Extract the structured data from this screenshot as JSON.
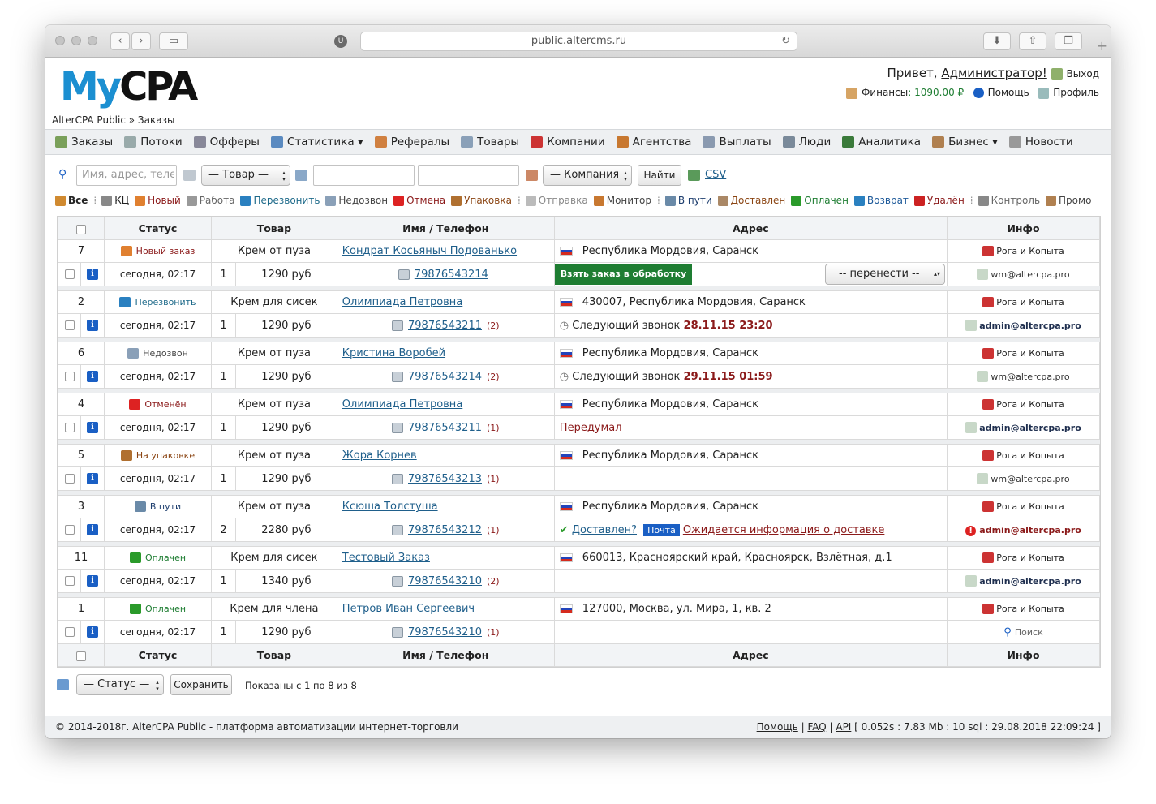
{
  "browser": {
    "url": "public.altercms.ru"
  },
  "header": {
    "logo_my": "My",
    "logo_cpa": "CPA",
    "greeting": "Привет, ",
    "user": "Администратор!",
    "logout": "Выход",
    "finance_label": "Финансы",
    "finance_value": ": 1090.00 ₽",
    "help": "Помощь",
    "profile": "Профиль"
  },
  "breadcrumb": "AlterCPA Public » Заказы",
  "menu": [
    "Заказы",
    "Потоки",
    "Офферы",
    "Статистика ▾",
    "Рефералы",
    "Товары",
    "Компании",
    "Агентства",
    "Выплаты",
    "Люди",
    "Аналитика",
    "Бизнес ▾",
    "Новости"
  ],
  "filters": {
    "search_placeholder": "Имя, адрес, телефон",
    "product": "— Товар —",
    "company": "— Компания —",
    "find": "Найти",
    "csv": "CSV"
  },
  "statuses": [
    "Все",
    "КЦ",
    "Новый",
    "Работа",
    "Перезвонить",
    "Недозвон",
    "Отмена",
    "Упаковка",
    "Отправка",
    "Монитор",
    "В пути",
    "Доставлен",
    "Оплачен",
    "Возврат",
    "Удалён",
    "Контроль",
    "Промо"
  ],
  "table": {
    "headers": [
      "Статус",
      "Товар",
      "Имя / Телефон",
      "Адрес",
      "Инфо"
    ],
    "rows": [
      {
        "id": "7",
        "status": "Новый заказ",
        "product": "Крем от пуза",
        "name": "Кондрат Косьяныч Подованько",
        "addr": "Республика Мордовия, Саранск",
        "company": "Рога и Копыта",
        "date": "сегодня, 02:17",
        "qty": "1",
        "price": "1290 руб",
        "phone": "79876543214",
        "count": "",
        "note": "",
        "wm": "wm@altercpa.pro"
      },
      {
        "id": "2",
        "status": "Перезвонить",
        "product": "Крем для сисек",
        "name": "Олимпиада Петровна",
        "addr": "430007, Республика Мордовия, Саранск",
        "company": "Рога и Копыта",
        "date": "сегодня, 02:17",
        "qty": "1",
        "price": "1290 руб",
        "phone": "79876543211",
        "count": "(2)",
        "note": "Следующий звонок ",
        "note2": "28.11.15 23:20",
        "wm": "admin@altercpa.pro"
      },
      {
        "id": "6",
        "status": "Недозвон",
        "product": "Крем от пуза",
        "name": "Кристина Воробей",
        "addr": "Республика Мордовия, Саранск",
        "company": "Рога и Копыта",
        "date": "сегодня, 02:17",
        "qty": "1",
        "price": "1290 руб",
        "phone": "79876543214",
        "count": "(2)",
        "note": "Следующий звонок ",
        "note2": "29.11.15 01:59",
        "wm": "wm@altercpa.pro"
      },
      {
        "id": "4",
        "status": "Отменён",
        "product": "Крем от пуза",
        "name": "Олимпиада Петровна",
        "addr": "Республика Мордовия, Саранск",
        "company": "Рога и Копыта",
        "date": "сегодня, 02:17",
        "qty": "1",
        "price": "1290 руб",
        "phone": "79876543211",
        "count": "(1)",
        "note": "Передумал",
        "note2": "",
        "wm": "admin@altercpa.pro"
      },
      {
        "id": "5",
        "status": "На упаковке",
        "product": "Крем от пуза",
        "name": "Жора Корнев",
        "addr": "Республика Мордовия, Саранск",
        "company": "Рога и Копыта",
        "date": "сегодня, 02:17",
        "qty": "1",
        "price": "1290 руб",
        "phone": "79876543213",
        "count": "(1)",
        "note": "",
        "note2": "",
        "wm": "wm@altercpa.pro"
      },
      {
        "id": "3",
        "status": "В пути",
        "product": "Крем от пуза",
        "name": "Ксюша Толстуша",
        "addr": "Республика Мордовия, Саранск",
        "company": "Рога и Копыта",
        "date": "сегодня, 02:17",
        "qty": "2",
        "price": "2280 руб",
        "phone": "79876543212",
        "count": "(1)",
        "note": "",
        "note2": "",
        "wm": "admin@altercpa.pro"
      },
      {
        "id": "11",
        "status": "Оплачен",
        "product": "Крем для сисек",
        "name": "Тестовый Заказ",
        "addr": "660013, Красноярский край, Красноярск, Взлётная, д.1",
        "company": "Рога и Копыта",
        "date": "сегодня, 02:17",
        "qty": "1",
        "price": "1340 руб",
        "phone": "79876543210",
        "count": "(2)",
        "note": "",
        "note2": "",
        "wm": "admin@altercpa.pro"
      },
      {
        "id": "1",
        "status": "Оплачен",
        "product": "Крем для члена",
        "name": "Петров Иван Сергеевич",
        "addr": "127000, Москва, ул. Мира, 1, кв. 2",
        "company": "Рога и Копыта",
        "date": "сегодня, 02:17",
        "qty": "1",
        "price": "1290 руб",
        "phone": "79876543210",
        "count": "(1)",
        "note": "",
        "note2": "",
        "wm": "Поиск"
      }
    ]
  },
  "row1_actions": {
    "take": "Взять заказ в обработку",
    "move": "-- перенести --"
  },
  "delivery": {
    "delivered": "Доставлен?",
    "post": "Почта",
    "waiting": "Ожидается информация о доставке"
  },
  "bottom": {
    "status": "— Статус —",
    "save": "Сохранить",
    "shown": "Показаны с 1 по 8 из 8"
  },
  "footer": {
    "copy": "© 2014-2018г. AlterCPA Public - платформа автоматизации интернет-торговли",
    "help": "Помощь",
    "faq": "FAQ",
    "api": "API",
    "stats": "[ 0.052s : 7.83 Mb : 10 sql : 29.08.2018 22:09:24 ]"
  }
}
